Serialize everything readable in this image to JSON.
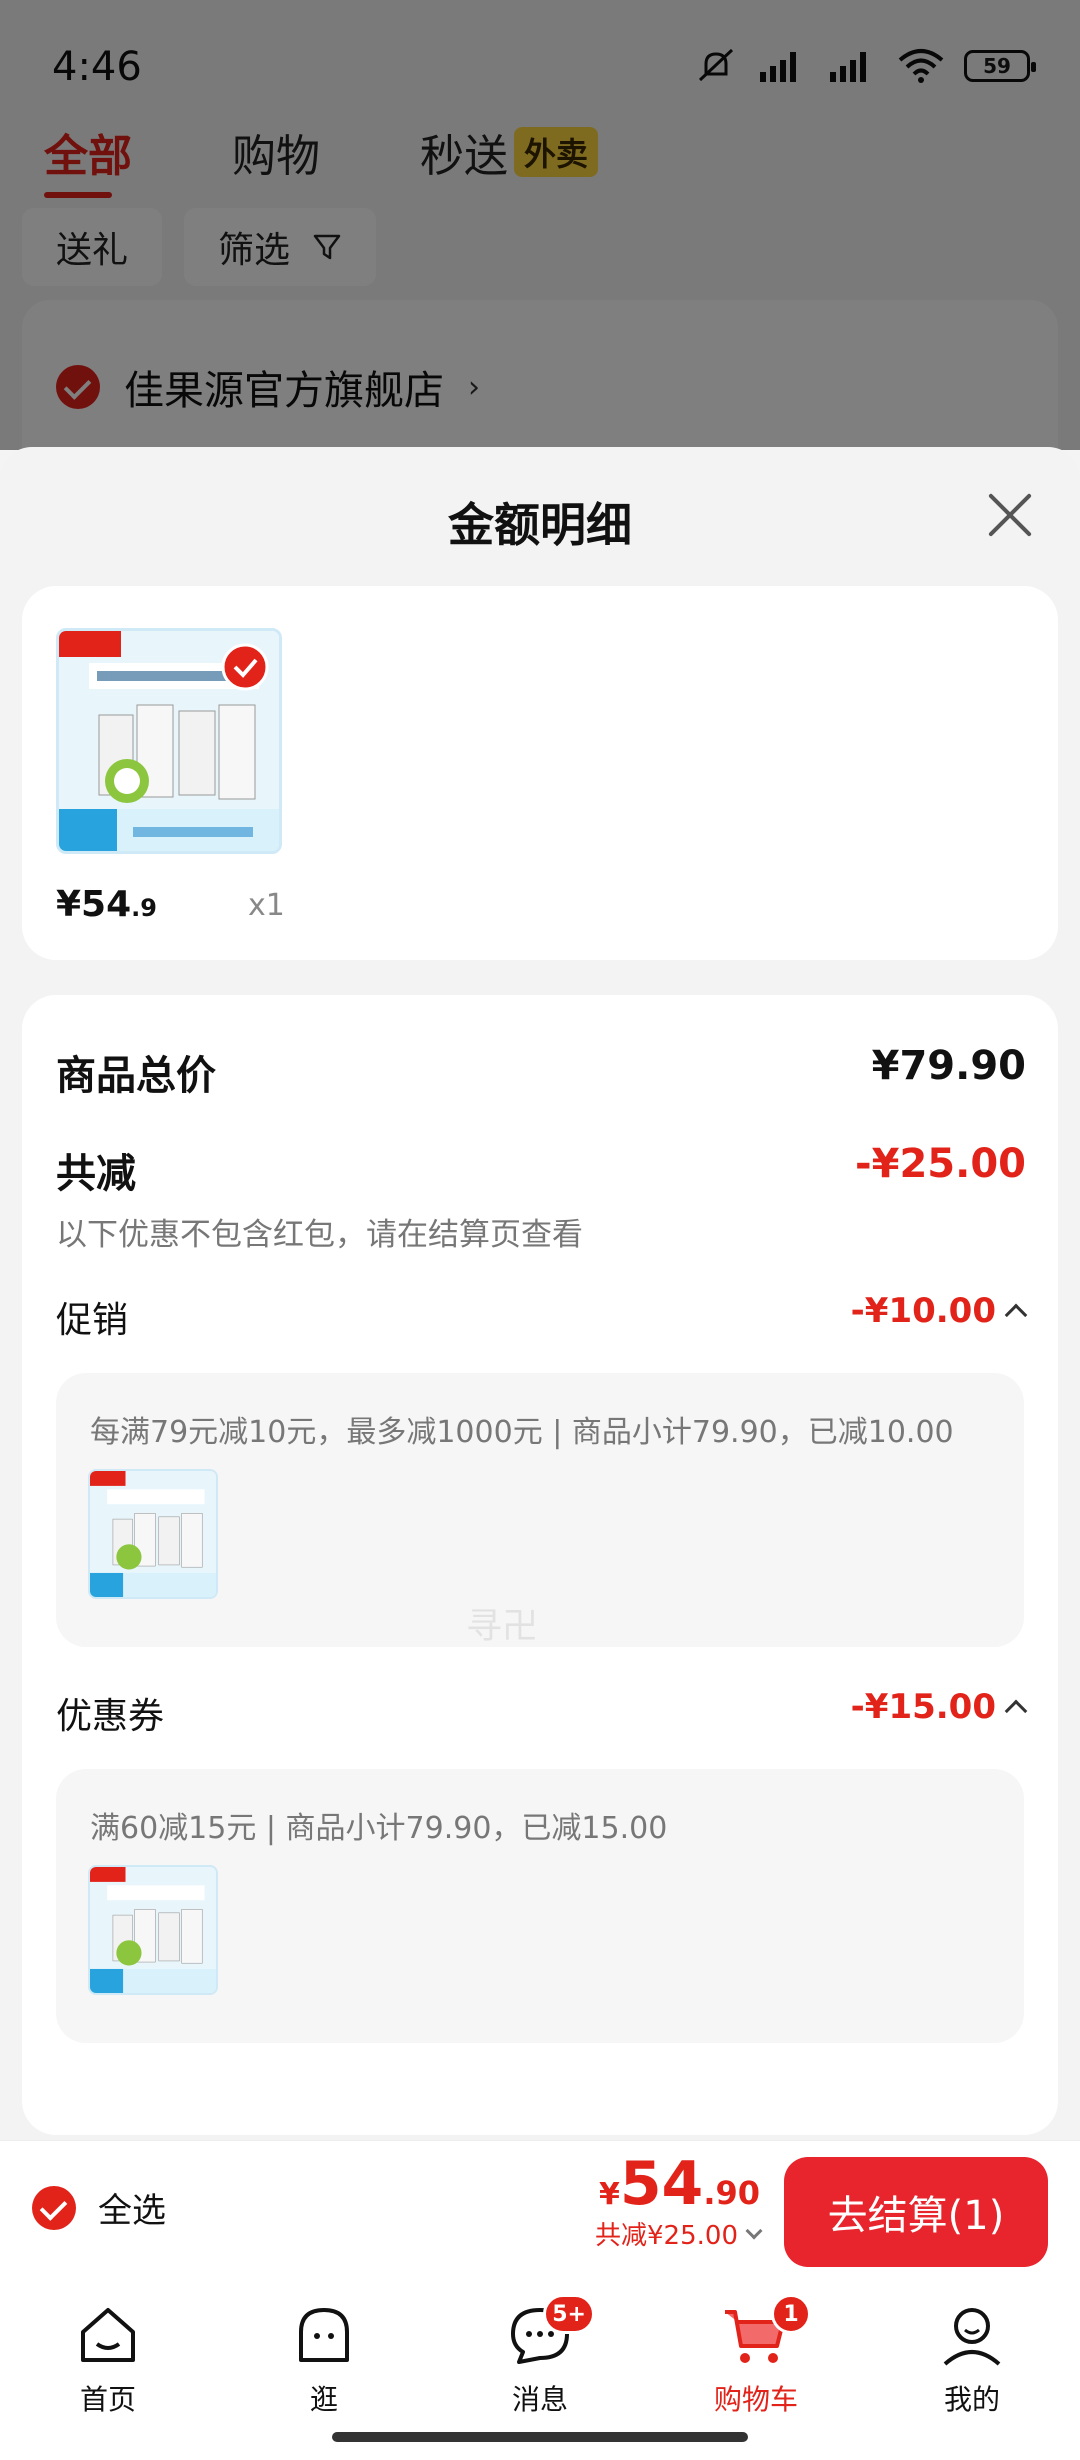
{
  "status_bar": {
    "time": "4:46",
    "battery": "59"
  },
  "top_tabs": [
    {
      "label": "全部",
      "active": true
    },
    {
      "label": "购物",
      "active": false
    },
    {
      "label": "秒送",
      "active": false,
      "badge": "外卖"
    }
  ],
  "filters": {
    "gift": "送礼",
    "filter": "筛选"
  },
  "store": {
    "name": "佳果源官方旗舰店"
  },
  "sheet": {
    "title": "金额明细",
    "product": {
      "price_main": "¥54",
      "price_decimal": ".9",
      "qty": "x1"
    },
    "subtotal": {
      "label": "商品总价",
      "value": "¥79.90"
    },
    "discount": {
      "label": "共减",
      "value": "-¥25.00",
      "note": "以下优惠不包含红包，请在结算页查看"
    },
    "promotion": {
      "label": "促销",
      "value": "-¥10.00",
      "desc": "每满79元减10元，最多减1000元 | 商品小计79.90，已减10.00"
    },
    "coupon": {
      "label": "优惠券",
      "value": "-¥15.00",
      "desc": "满60减15元 | 商品小计79.90，已减15.00"
    },
    "watermark": "寻卍"
  },
  "checkout": {
    "select_all": "全选",
    "currency": "¥",
    "price_main": "54",
    "price_decimal": ".90",
    "saved": "共减¥25.00",
    "button": "去结算(1)"
  },
  "nav": [
    {
      "label": "首页",
      "icon": "home-icon"
    },
    {
      "label": "逛",
      "icon": "browse-icon"
    },
    {
      "label": "消息",
      "icon": "message-icon",
      "badge": "5+"
    },
    {
      "label": "购物车",
      "icon": "cart-icon",
      "badge": "1",
      "active": true
    },
    {
      "label": "我的",
      "icon": "profile-icon"
    }
  ],
  "colors": {
    "accent": "#e2231a",
    "sheet_bg": "#f3f3f3"
  }
}
